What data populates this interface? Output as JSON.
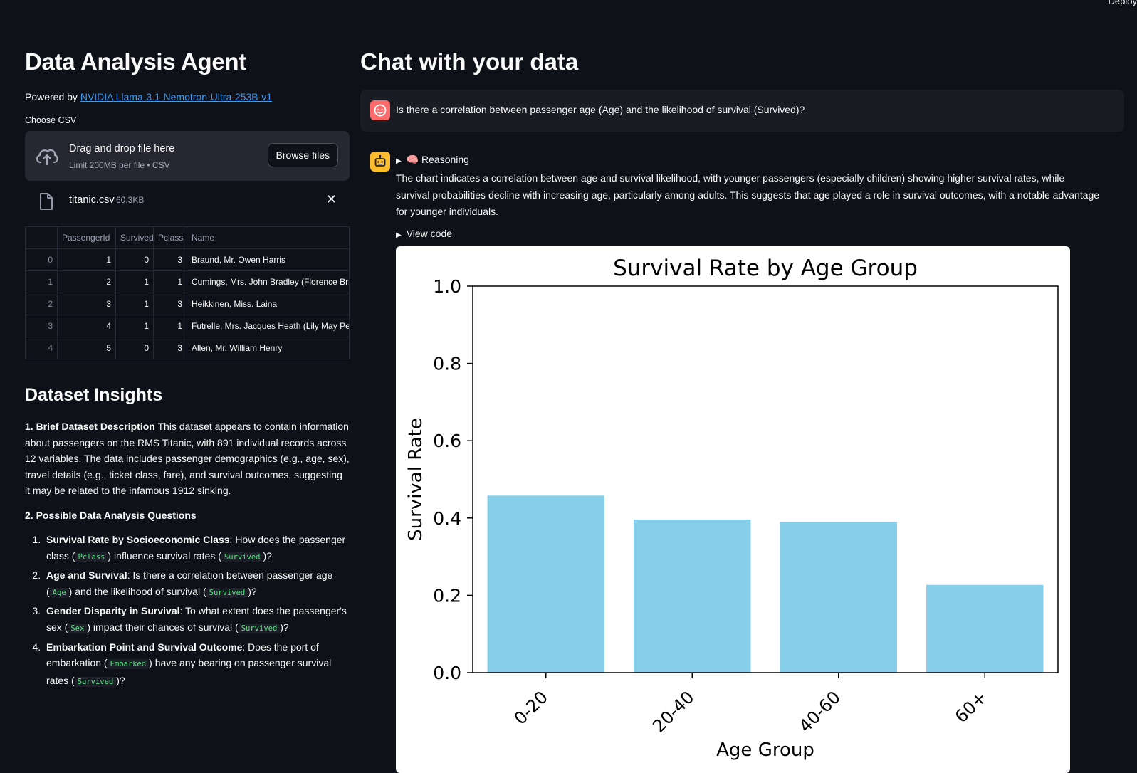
{
  "header": {
    "deploy_label": "Deploy"
  },
  "sidebar": {
    "title": "Data Analysis Agent",
    "powered_prefix": "Powered by",
    "powered_link": "NVIDIA Llama-3.1-Nemotron-Ultra-253B-v1",
    "choose_label": "Choose CSV",
    "dropzone": {
      "primary": "Drag and drop file here",
      "secondary": "Limit 200MB per file • CSV",
      "browse_label": "Browse files",
      "icon": "cloud-upload-icon"
    },
    "file": {
      "name": "titanic.csv",
      "size": "60.3KB",
      "icon": "file-icon",
      "remove_icon": "close-icon"
    },
    "table": {
      "columns": [
        "",
        "PassengerId",
        "Survived",
        "Pclass",
        "Name"
      ],
      "rows": [
        [
          "0",
          "1",
          "0",
          "3",
          "Braund, Mr. Owen Harris"
        ],
        [
          "1",
          "2",
          "1",
          "1",
          "Cumings, Mrs. John Bradley (Florence Bri"
        ],
        [
          "2",
          "3",
          "1",
          "3",
          "Heikkinen, Miss. Laina"
        ],
        [
          "3",
          "4",
          "1",
          "1",
          "Futrelle, Mrs. Jacques Heath (Lily May Pe"
        ],
        [
          "4",
          "5",
          "0",
          "3",
          "Allen, Mr. William Henry"
        ]
      ]
    },
    "insights": {
      "title": "Dataset Insights",
      "desc_bold": "1. Brief Dataset Description",
      "desc_text": "This dataset appears to contain information about passengers on the RMS Titanic, with 891 individual records across 12 variables. The data includes passenger demographics (e.g., age, sex), travel details (e.g., ticket class, fare), and survival outcomes, suggesting it may be related to the infamous 1912 sinking.",
      "questions_title": "2. Possible Data Analysis Questions",
      "questions": [
        {
          "bold": "Survival Rate by Socioeconomic Class",
          "t1": ": How does the passenger class (",
          "c1": "Pclass",
          "t2": ") influence survival rates (",
          "c2": "Survived",
          "t3": ")?"
        },
        {
          "bold": "Age and Survival",
          "t1": ": Is there a correlation between passenger age (",
          "c1": "Age",
          "t2": ") and the likelihood of survival (",
          "c2": "Survived",
          "t3": ")?"
        },
        {
          "bold": "Gender Disparity in Survival",
          "t1": ": To what extent does the passenger's sex (",
          "c1": "Sex",
          "t2": ") impact their chances of survival (",
          "c2": "Survived",
          "t3": ")?"
        },
        {
          "bold": "Embarkation Point and Survival Outcome",
          "t1": ": Does the port of embarkation (",
          "c1": "Embarked",
          "t2": ") have any bearing on passenger survival rates (",
          "c2": "Survived",
          "t3": ")?"
        }
      ]
    }
  },
  "chat": {
    "title": "Chat with your data",
    "user_message": "Is there a correlation between passenger age (Age) and the likelihood of survival (Survived)?",
    "reasoning_label": "🧠 Reasoning",
    "answer": "The chart indicates a correlation between age and survival likelihood, with younger passengers (especially children) showing higher survival rates, while survival probabilities decline with increasing age, particularly among adults. This suggests that age played a role in survival outcomes, with a notable advantage for younger individuals.",
    "view_code_label": "View code",
    "colors": {
      "user_avatar": "#ff6b6b",
      "assistant_avatar": "#fbbc2d"
    }
  },
  "chart_data": {
    "type": "bar",
    "title": "Survival Rate by Age Group",
    "xlabel": "Age Group",
    "ylabel": "Survival Rate",
    "categories": [
      "0-20",
      "20-40",
      "40-60",
      "60+"
    ],
    "values": [
      0.458,
      0.396,
      0.39,
      0.227
    ],
    "ylim": [
      0,
      1.0
    ],
    "yticks": [
      "0.0",
      "0.2",
      "0.4",
      "0.6",
      "0.8",
      "1.0"
    ],
    "bar_color": "#87ceeb",
    "grid": false
  }
}
